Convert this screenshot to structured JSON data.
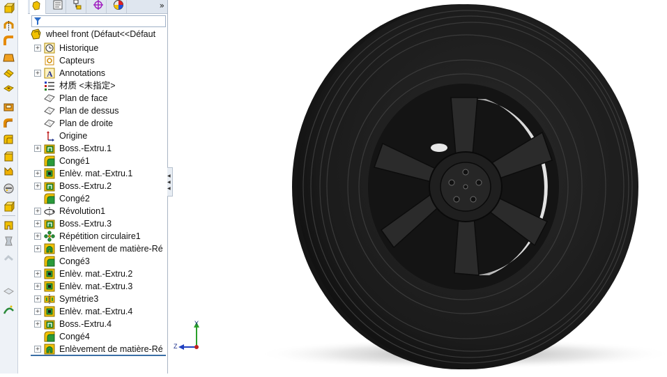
{
  "toolbar": {
    "tools": [
      {
        "icon": "extruded-boss-icon"
      },
      {
        "icon": "revolved-boss-icon"
      },
      {
        "icon": "swept-boss-icon"
      },
      {
        "icon": "lofted-boss-icon"
      },
      {
        "icon": "boundary-boss-icon"
      },
      {
        "icon": "extruded-cut-icon"
      },
      {
        "icon": "revolved-cut-icon"
      },
      {
        "icon": "swept-cut-icon"
      },
      {
        "icon": "fillet-icon"
      },
      {
        "icon": "chamfer-icon"
      },
      {
        "icon": "rib-icon"
      },
      {
        "icon": "shell-icon"
      },
      {
        "icon": "draft-icon"
      },
      {
        "icon": "hole-wizard-icon"
      },
      {
        "icon": "wrap-icon"
      },
      {
        "icon": "dome-icon"
      },
      {
        "icon": "reference-geometry-icon"
      },
      {
        "icon": "curves-icon"
      }
    ]
  },
  "panel": {
    "tabs": [
      {
        "name": "featuremanager-tab",
        "icon": "featuremanager-icon"
      },
      {
        "name": "propertymanager-tab",
        "icon": "propertymanager-icon"
      },
      {
        "name": "configurationmanager-tab",
        "icon": "configurationmanager-icon"
      },
      {
        "name": "dimxpert-tab",
        "icon": "dimxpert-icon"
      },
      {
        "name": "displaymanager-tab",
        "icon": "displaymanager-icon"
      }
    ],
    "more_tabs": "»",
    "filter_icon": "filter-icon"
  },
  "tree": {
    "root": "wheel front  (Défaut<<Défaut",
    "items": [
      {
        "label": "Historique",
        "icon": "history-icon",
        "expandable": true
      },
      {
        "label": "Capteurs",
        "icon": "sensors-icon",
        "expandable": false
      },
      {
        "label": "Annotations",
        "icon": "annotations-icon",
        "expandable": true
      },
      {
        "label": "材质 <未指定>",
        "icon": "material-icon",
        "expandable": false
      },
      {
        "label": "Plan de face",
        "icon": "plane-icon",
        "expandable": false
      },
      {
        "label": "Plan de dessus",
        "icon": "plane-icon",
        "expandable": false
      },
      {
        "label": "Plan de droite",
        "icon": "plane-icon",
        "expandable": false
      },
      {
        "label": "Origine",
        "icon": "origin-icon",
        "expandable": false
      },
      {
        "label": "Boss.-Extru.1",
        "icon": "extrude-feature-icon",
        "expandable": true
      },
      {
        "label": "Congé1",
        "icon": "fillet-feature-icon",
        "expandable": false
      },
      {
        "label": "Enlèv. mat.-Extru.1",
        "icon": "cut-extrude-feature-icon",
        "expandable": true
      },
      {
        "label": "Boss.-Extru.2",
        "icon": "extrude-feature-icon",
        "expandable": true
      },
      {
        "label": "Congé2",
        "icon": "fillet-feature-icon",
        "expandable": false
      },
      {
        "label": "Révolution1",
        "icon": "revolve-feature-icon",
        "expandable": true
      },
      {
        "label": "Boss.-Extru.3",
        "icon": "extrude-feature-icon",
        "expandable": true
      },
      {
        "label": "Répétition circulaire1",
        "icon": "circular-pattern-icon",
        "expandable": true
      },
      {
        "label": "Enlèvement de matière-Ré",
        "icon": "cut-revolve-feature-icon",
        "expandable": true
      },
      {
        "label": "Congé3",
        "icon": "fillet-feature-icon",
        "expandable": false
      },
      {
        "label": "Enlèv. mat.-Extru.2",
        "icon": "cut-extrude-feature-icon",
        "expandable": true
      },
      {
        "label": "Enlèv. mat.-Extru.3",
        "icon": "cut-extrude-feature-icon",
        "expandable": true
      },
      {
        "label": "Symétrie3",
        "icon": "mirror-feature-icon",
        "expandable": true
      },
      {
        "label": "Enlèv. mat.-Extru.4",
        "icon": "cut-extrude-feature-icon",
        "expandable": true
      },
      {
        "label": "Boss.-Extru.4",
        "icon": "extrude-feature-icon",
        "expandable": true
      },
      {
        "label": "Congé4",
        "icon": "fillet-feature-icon",
        "expandable": false
      },
      {
        "label": "Enlèvement de matière-Ré",
        "icon": "cut-revolve-feature-icon",
        "expandable": true
      }
    ]
  },
  "viewport": {
    "model": "wheel-3d-model",
    "triad": {
      "y": "Y",
      "z": "Z"
    }
  },
  "colors": {
    "tire": "#1d1d1d",
    "panel_bg": "#ffffff",
    "toolbar_bg": "#eef2f7",
    "feature_yellow": "#f2c200",
    "feature_green": "#2a9a3a"
  }
}
